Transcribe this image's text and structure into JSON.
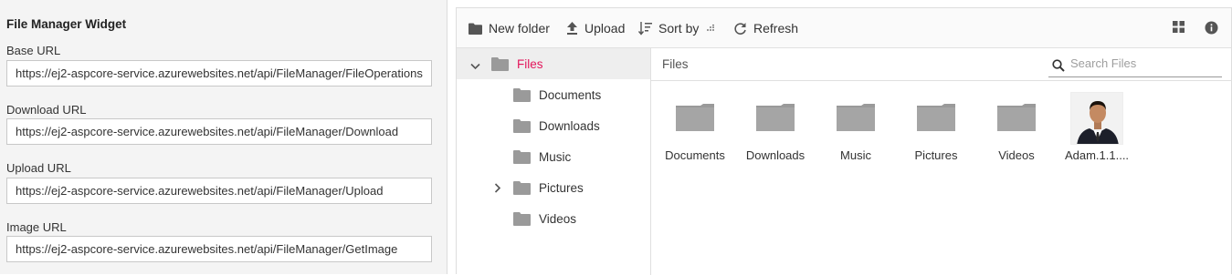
{
  "settings": {
    "title": "File Manager Widget",
    "fields": [
      {
        "label": "Base URL",
        "value": "https://ej2-aspcore-service.azurewebsites.net/api/FileManager/FileOperations"
      },
      {
        "label": "Download URL",
        "value": "https://ej2-aspcore-service.azurewebsites.net/api/FileManager/Download"
      },
      {
        "label": "Upload URL",
        "value": "https://ej2-aspcore-service.azurewebsites.net/api/FileManager/Upload"
      },
      {
        "label": "Image URL",
        "value": "https://ej2-aspcore-service.azurewebsites.net/api/FileManager/GetImage"
      }
    ]
  },
  "toolbar": {
    "new_folder": "New folder",
    "upload": "Upload",
    "sort_by": "Sort by",
    "refresh": "Refresh",
    "icons": [
      "folder-icon",
      "upload-icon",
      "sort-icon",
      "refresh-icon",
      "grid-view-icon",
      "info-icon"
    ]
  },
  "tree": {
    "root": "Files",
    "children": [
      "Documents",
      "Downloads",
      "Music",
      "Pictures",
      "Videos"
    ]
  },
  "breadcrumb": "Files",
  "search": {
    "placeholder": "Search Files"
  },
  "items": [
    {
      "name": "Documents",
      "type": "folder"
    },
    {
      "name": "Downloads",
      "type": "folder"
    },
    {
      "name": "Music",
      "type": "folder"
    },
    {
      "name": "Pictures",
      "type": "folder"
    },
    {
      "name": "Videos",
      "type": "folder"
    },
    {
      "name": "Adam.1.1....",
      "type": "image"
    }
  ],
  "colors": {
    "accent": "#e3165b",
    "folder": "#9a9a9a",
    "panel_bg": "#f4f4f4"
  }
}
